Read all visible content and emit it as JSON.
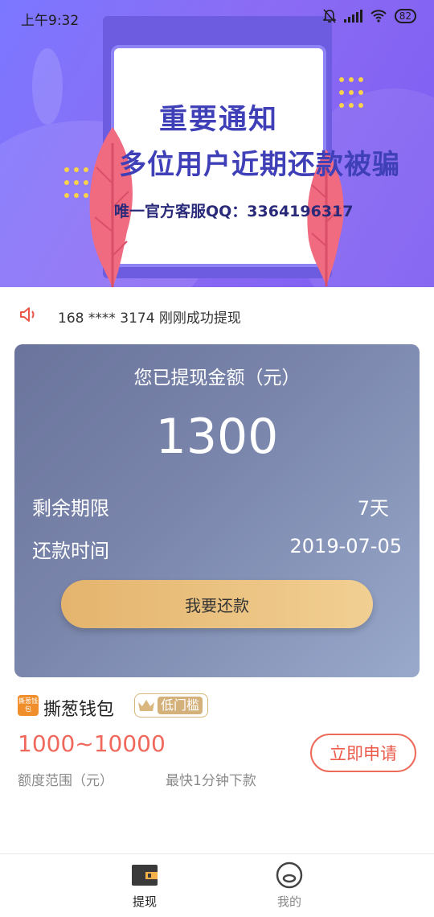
{
  "status_bar": {
    "time": "上午9:32",
    "battery": "82"
  },
  "banner": {
    "title": "重要通知",
    "line2": "多位用户近期还款被骗",
    "line3": "唯一官方客服QQ：3364196317"
  },
  "ticker": {
    "text": "168 **** 3174 刚刚成功提现",
    "icon": "speaker-icon"
  },
  "summary": {
    "title": "您已提现金额（元）",
    "amount": "1300",
    "remaining_label": "剩余期限",
    "remaining_value": "7天",
    "repay_time_label": "还款时间",
    "repay_time_value": "2019-07-05",
    "repay_button": "我要还款"
  },
  "product": {
    "logo_text": "撕葱钱包",
    "name": "撕葱钱包",
    "tag": "低门槛",
    "range": "1000~10000",
    "range_label": "额度范围（元）",
    "speed": "最快1分钟下款",
    "apply_button": "立即申请"
  },
  "tabbar": {
    "tabs": [
      {
        "label": "提现",
        "icon": "wallet-icon",
        "active": true
      },
      {
        "label": "我的",
        "icon": "profile-icon",
        "active": false
      }
    ]
  },
  "colors": {
    "accent": "#ec5a4c",
    "button_gold": "#e4b46d",
    "card_blue": "#7b86ac",
    "banner_purple": "#7d6cf6"
  }
}
